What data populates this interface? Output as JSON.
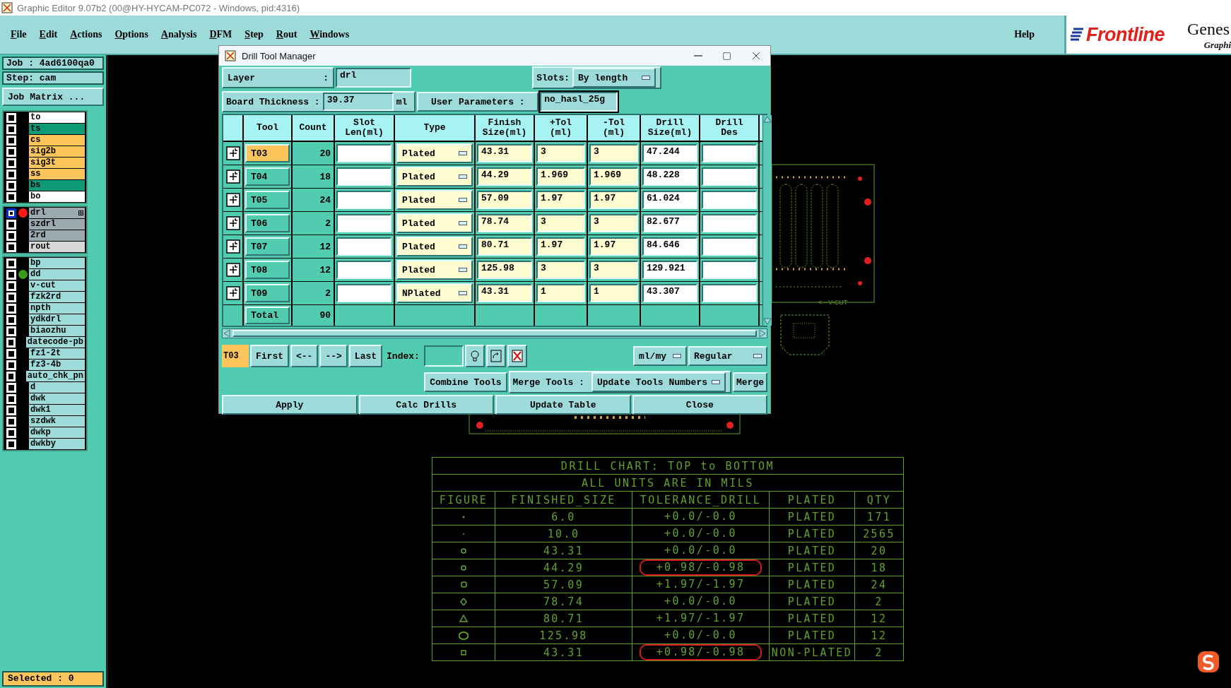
{
  "app": {
    "title": "Graphic Editor 9.07b2 (00@HY-HYCAM-PC072 - Windows, pid:4316)"
  },
  "menu": [
    "File",
    "Edit",
    "Actions",
    "Options",
    "Analysis",
    "DFM",
    "Step",
    "Rout",
    "Windows"
  ],
  "help": "Help",
  "logo": {
    "brand": "Frontline",
    "product": "Genes",
    "subtitle": "Graphi"
  },
  "job_panel": {
    "job": "Job : 4ad6100qa0",
    "step": "Step: cam",
    "matrix_button": "Job Matrix ...",
    "groups": [
      {
        "layers": [
          {
            "name": "to",
            "color": "#ffffff",
            "selected": false
          },
          {
            "name": "ts",
            "color": "#0f9a78",
            "selected": false
          },
          {
            "name": "cs",
            "color": "#fcc55c",
            "selected": false
          },
          {
            "name": "sig2b",
            "color": "#fcc55c",
            "selected": false
          },
          {
            "name": "sig3t",
            "color": "#fcc55c",
            "selected": false
          },
          {
            "name": "ss",
            "color": "#fcc55c",
            "selected": false
          },
          {
            "name": "bs",
            "color": "#0f9a78",
            "selected": false
          },
          {
            "name": "bo",
            "color": "#ffffff",
            "selected": false
          }
        ]
      },
      {
        "layers": [
          {
            "name": "drl",
            "color": "#9aaab0",
            "selected": true,
            "dot": {
              "color": "#ff1a1a"
            }
          },
          {
            "name": "szdrl",
            "color": "#9aaab0",
            "selected": false
          },
          {
            "name": "2rd",
            "color": "#9aaab0",
            "selected": false
          },
          {
            "name": "rout",
            "color": "#d8d8d8",
            "selected": false
          }
        ]
      },
      {
        "layers": [
          {
            "name": "bp",
            "color": "#9ddbdb",
            "selected": false
          },
          {
            "name": "dd",
            "color": "#9ddbdb",
            "selected": false,
            "dot": {
              "color": "#3a9a1a"
            }
          },
          {
            "name": "v-cut",
            "color": "#9ddbdb",
            "selected": false
          },
          {
            "name": "fzk2rd",
            "color": "#9ddbdb",
            "selected": false
          },
          {
            "name": "npth",
            "color": "#9ddbdb",
            "selected": false
          },
          {
            "name": "ydkdrl",
            "color": "#9ddbdb",
            "selected": false
          },
          {
            "name": "biaozhu",
            "color": "#9ddbdb",
            "selected": false
          },
          {
            "name": "datecode-pb",
            "color": "#9ddbdb",
            "selected": false
          },
          {
            "name": "fz1-2t",
            "color": "#9ddbdb",
            "selected": false
          },
          {
            "name": "fz3-4b",
            "color": "#9ddbdb",
            "selected": false
          },
          {
            "name": "auto_chk_pn",
            "color": "#9ddbdb",
            "selected": false
          },
          {
            "name": "d",
            "color": "#9ddbdb",
            "selected": false
          },
          {
            "name": "dwk",
            "color": "#9ddbdb",
            "selected": false
          },
          {
            "name": "dwk1",
            "color": "#9ddbdb",
            "selected": false
          },
          {
            "name": "szdwk",
            "color": "#9ddbdb",
            "selected": false
          },
          {
            "name": "dwkp",
            "color": "#9ddbdb",
            "selected": false
          },
          {
            "name": "dwkby",
            "color": "#9ddbdb",
            "selected": false
          }
        ]
      }
    ],
    "status": "Selected : 0"
  },
  "dialog": {
    "title": "Drill Tool Manager",
    "layer": {
      "label": "Layer",
      "colon": ":",
      "value": "drl"
    },
    "slots": {
      "label": "Slots:",
      "value": "By length"
    },
    "thickness": {
      "label": "Board Thickness :",
      "value": "39.37",
      "unit": "ml"
    },
    "user_params": {
      "label": "User Parameters :",
      "value": "no_hasl_25g"
    },
    "columns": [
      {
        "lines": [
          "Tool"
        ]
      },
      {
        "lines": [
          "Count"
        ]
      },
      {
        "lines": [
          "Slot",
          "Len(ml)"
        ]
      },
      {
        "lines": [
          "Type"
        ]
      },
      {
        "lines": [
          "Finish",
          "Size(ml)"
        ]
      },
      {
        "lines": [
          "+Tol",
          "(ml)"
        ]
      },
      {
        "lines": [
          "-Tol",
          "(ml)"
        ]
      },
      {
        "lines": [
          "Drill",
          "Size(ml)"
        ]
      },
      {
        "lines": [
          "Drill",
          "Des"
        ]
      }
    ],
    "rows": [
      {
        "tool": "T03",
        "selected": true,
        "count": "20",
        "type": "Plated",
        "finish": "43.31",
        "plus_tol": "3",
        "minus_tol": "3",
        "drill_size": "47.244"
      },
      {
        "tool": "T04",
        "selected": false,
        "count": "18",
        "type": "Plated",
        "finish": "44.29",
        "plus_tol": "1.969",
        "minus_tol": "1.969",
        "drill_size": "48.228"
      },
      {
        "tool": "T05",
        "selected": false,
        "count": "24",
        "type": "Plated",
        "finish": "57.09",
        "plus_tol": "1.97",
        "minus_tol": "1.97",
        "drill_size": "61.024"
      },
      {
        "tool": "T06",
        "selected": false,
        "count": "2",
        "type": "Plated",
        "finish": "78.74",
        "plus_tol": "3",
        "minus_tol": "3",
        "drill_size": "82.677"
      },
      {
        "tool": "T07",
        "selected": false,
        "count": "12",
        "type": "Plated",
        "finish": "80.71",
        "plus_tol": "1.97",
        "minus_tol": "1.97",
        "drill_size": "84.646"
      },
      {
        "tool": "T08",
        "selected": false,
        "count": "12",
        "type": "Plated",
        "finish": "125.98",
        "plus_tol": "3",
        "minus_tol": "3",
        "drill_size": "129.921"
      },
      {
        "tool": "T09",
        "selected": false,
        "count": "2",
        "type": "NPlated",
        "finish": "43.31",
        "plus_tol": "1",
        "minus_tol": "1",
        "drill_size": "43.307"
      }
    ],
    "total": {
      "label": "Total",
      "count": "90"
    },
    "nav": {
      "current": "T03",
      "buttons": [
        "First",
        "<--",
        "-->",
        "Last"
      ],
      "index_label": "Index:",
      "units": "ml/my",
      "mode": "Regular"
    },
    "merge": {
      "combine": "Combine Tools",
      "label": "Merge Tools :",
      "option": "Update Tools Numbers",
      "merge": "Merge"
    },
    "actions": [
      "Apply",
      "Calc Drills",
      "Update Table",
      "Close"
    ]
  },
  "drill_chart": {
    "title": "DRILL CHART: TOP to BOTTOM",
    "subtitle": "ALL UNITS ARE IN MILS",
    "columns": [
      "FIGURE",
      "FINISHED_SIZE",
      "TOLERANCE_DRILL",
      "PLATED",
      "QTY"
    ],
    "rows": [
      {
        "figure": {
          "kind": "dot"
        },
        "finished": "6.0",
        "tolerance": "+0.0/-0.0",
        "plated": "PLATED",
        "qty": "171",
        "circled": false
      },
      {
        "figure": {
          "kind": "speck"
        },
        "finished": "10.0",
        "tolerance": "+0.0/-0.0",
        "plated": "PLATED",
        "qty": "2565",
        "circled": false
      },
      {
        "figure": {
          "kind": "ring"
        },
        "finished": "43.31",
        "tolerance": "+0.0/-0.0",
        "plated": "PLATED",
        "qty": "20",
        "circled": false
      },
      {
        "figure": {
          "kind": "ring"
        },
        "finished": "44.29",
        "tolerance": "+0.98/-0.98",
        "plated": "PLATED",
        "qty": "18",
        "circled": true
      },
      {
        "figure": {
          "kind": "rounded"
        },
        "finished": "57.09",
        "tolerance": "+1.97/-1.97",
        "plated": "PLATED",
        "qty": "24",
        "circled": false
      },
      {
        "figure": {
          "kind": "diamond"
        },
        "finished": "78.74",
        "tolerance": "+0.0/-0.0",
        "plated": "PLATED",
        "qty": "2",
        "circled": false
      },
      {
        "figure": {
          "kind": "triangle"
        },
        "finished": "80.71",
        "tolerance": "+1.97/-1.97",
        "plated": "PLATED",
        "qty": "12",
        "circled": false
      },
      {
        "figure": {
          "kind": "oval"
        },
        "finished": "125.98",
        "tolerance": "+0.0/-0.0",
        "plated": "PLATED",
        "qty": "12",
        "circled": false
      },
      {
        "figure": {
          "kind": "square"
        },
        "finished": "43.31",
        "tolerance": "+0.98/-0.98",
        "plated": "NON-PLATED",
        "qty": "2",
        "circled": true
      }
    ]
  },
  "canvas": {
    "vcut_label": "<---V-CUT"
  }
}
